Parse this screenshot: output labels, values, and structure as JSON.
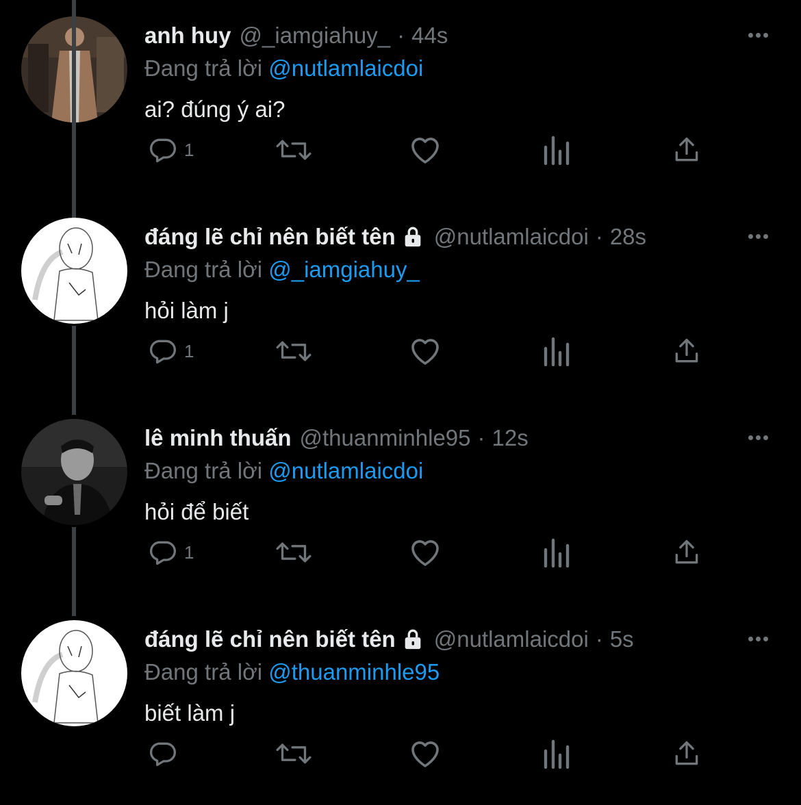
{
  "tweets": [
    {
      "name": "anh huy",
      "handle": "@_iamgiahuy_",
      "time": "44s",
      "locked": false,
      "reply_prefix": "Đang trả lời",
      "reply_to": "@nutlamlaicdoi",
      "text": "ai? đúng ý ai?",
      "reply_count": "1",
      "avatar": "photo-man-beige-suit"
    },
    {
      "name": "đáng lẽ chỉ nên biết tên",
      "handle": "@nutlamlaicdoi",
      "time": "28s",
      "locked": true,
      "reply_prefix": "Đang trả lời",
      "reply_to": "@_iamgiahuy_",
      "text": "hỏi làm j",
      "reply_count": "1",
      "avatar": "sketch-drawing"
    },
    {
      "name": "lê minh thuấn",
      "handle": "@thuanminhle95",
      "time": "12s",
      "locked": false,
      "reply_prefix": "Đang trả lời",
      "reply_to": "@nutlamlaicdoi",
      "text": "hỏi để biết",
      "reply_count": "1",
      "avatar": "photo-man-black-white"
    },
    {
      "name": "đáng lẽ chỉ nên biết tên",
      "handle": "@nutlamlaicdoi",
      "time": "5s",
      "locked": true,
      "reply_prefix": "Đang trả lời",
      "reply_to": "@thuanminhle95",
      "text": "biết làm j",
      "reply_count": "",
      "avatar": "sketch-drawing"
    }
  ],
  "separator": "·",
  "icons": [
    "reply-icon",
    "retweet-icon",
    "like-icon",
    "views-icon",
    "share-icon",
    "more-icon",
    "lock-icon"
  ],
  "colors": {
    "background": "#000000",
    "primary_text": "#e7e9ea",
    "secondary_text": "#71767b",
    "mention": "#1d9bf0",
    "thread_line": "#3b4045"
  }
}
